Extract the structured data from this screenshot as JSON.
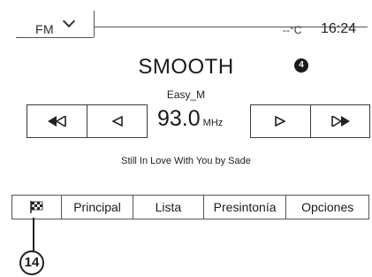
{
  "header": {
    "band_label": "FM",
    "temperature": "--°C",
    "time": "16:24"
  },
  "station": {
    "name": "SMOOTH",
    "preset_number": "4",
    "rds_text": "Easy_M",
    "frequency": "93.0",
    "frequency_unit": "MHz",
    "now_playing": "Still In Love With You by Sade"
  },
  "tuning": {
    "seek_back_icon": "double-left-triangle",
    "step_back_icon": "left-triangle",
    "step_forward_icon": "right-triangle",
    "seek_forward_icon": "double-right-triangle"
  },
  "menu": {
    "flag_icon": "checkered-flag",
    "items": [
      "Principal",
      "Lista",
      "Presintonía",
      "Opciones"
    ]
  },
  "callout": {
    "number": "14"
  }
}
